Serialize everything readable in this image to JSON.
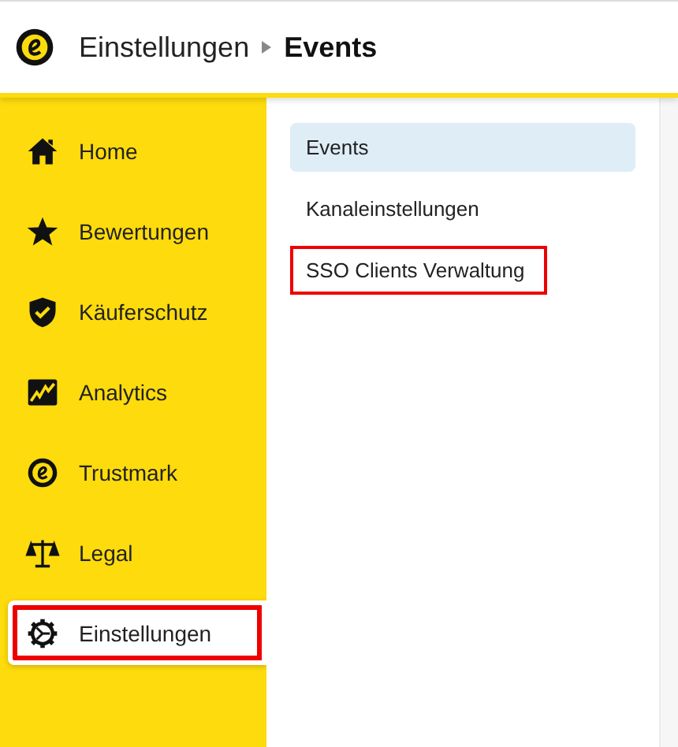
{
  "header": {
    "breadcrumb": [
      "Einstellungen",
      "Events"
    ]
  },
  "sidebar": {
    "items": [
      {
        "label": "Home",
        "kind": "home",
        "selected": false,
        "highlighted": false
      },
      {
        "label": "Bewertungen",
        "kind": "star",
        "selected": false,
        "highlighted": false
      },
      {
        "label": "Käuferschutz",
        "kind": "shield",
        "selected": false,
        "highlighted": false
      },
      {
        "label": "Analytics",
        "kind": "chart",
        "selected": false,
        "highlighted": false
      },
      {
        "label": "Trustmark",
        "kind": "trustmark",
        "selected": false,
        "highlighted": false
      },
      {
        "label": "Legal",
        "kind": "scales",
        "selected": false,
        "highlighted": false
      },
      {
        "label": "Einstellungen",
        "kind": "gear",
        "selected": true,
        "highlighted": true
      }
    ]
  },
  "submenu": {
    "items": [
      {
        "label": "Events",
        "selected": true,
        "highlighted": false
      },
      {
        "label": "Kanaleinstellungen",
        "selected": false,
        "highlighted": false
      },
      {
        "label": "SSO Clients Verwaltung",
        "selected": false,
        "highlighted": true
      }
    ]
  }
}
